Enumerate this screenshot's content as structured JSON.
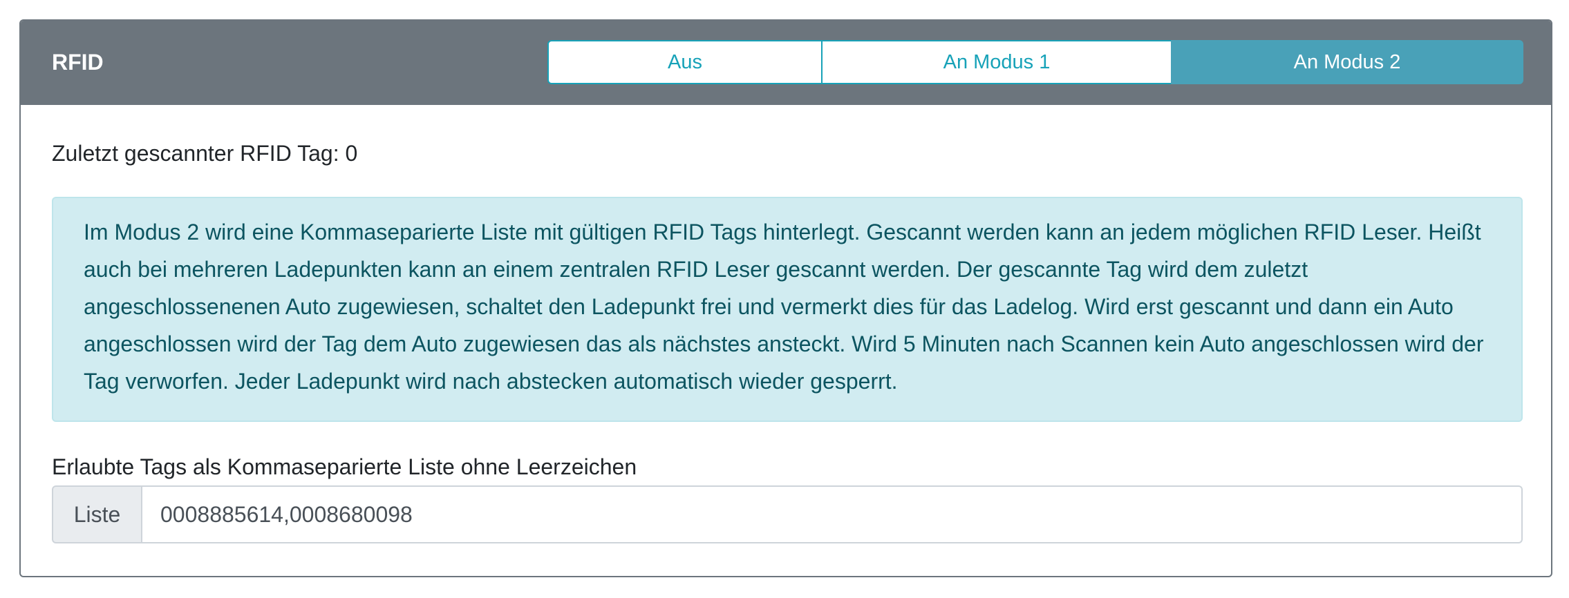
{
  "card": {
    "title": "RFID"
  },
  "mode_buttons": {
    "off_label": "Aus",
    "mode1_label": "An Modus 1",
    "mode2_label": "An Modus 2",
    "active": "An Modus 2"
  },
  "last_scanned": {
    "text": "Zuletzt gescannter RFID Tag: 0"
  },
  "info_alert": {
    "text": "Im Modus 2 wird eine Kommaseparierte Liste mit gültigen RFID Tags hinterlegt. Gescannt werden kann an jedem möglichen RFID Leser. Heißt auch bei mehreren Ladepunkten kann an einem zentralen RFID Leser gescannt werden. Der gescannte Tag wird dem zuletzt angeschlossenenen Auto zugewiesen, schaltet den Ladepunkt frei und vermerkt dies für das Ladelog. Wird erst gescannt und dann ein Auto angeschlossen wird der Tag dem Auto zugewiesen das als nächstes ansteckt. Wird 5 Minuten nach Scannen kein Auto angeschlossen wird der Tag verworfen. Jeder Ladepunkt wird nach abstecken automatisch wieder gesperrt."
  },
  "allowed_tags": {
    "label": "Erlaubte Tags als Kommaseparierte Liste ohne Leerzeichen",
    "prepend": "Liste",
    "value": "0008885614,0008680098"
  },
  "colors": {
    "header_bg": "#6c757d",
    "accent": "#17a2b8",
    "active_button": "#49a1b8",
    "alert_bg": "#d1ecf1",
    "alert_text": "#0c5460"
  }
}
